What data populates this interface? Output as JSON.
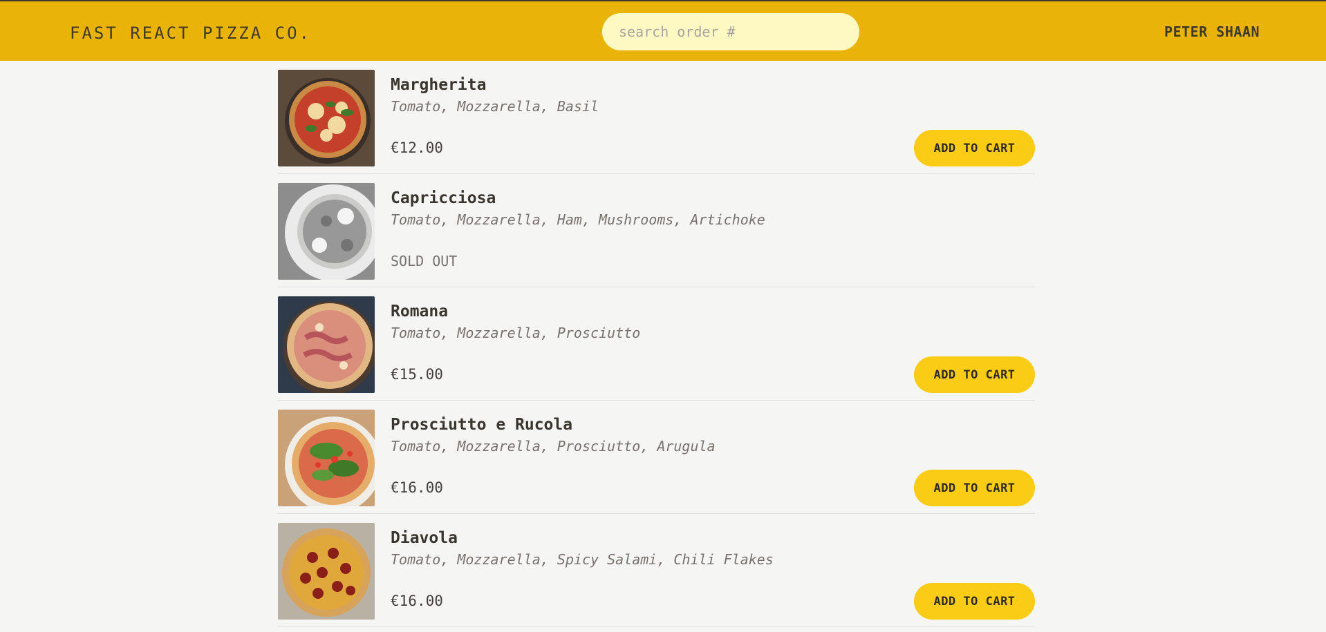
{
  "header": {
    "logo": "FAST REACT PIZZA CO.",
    "search_placeholder": "search order #",
    "search_value": "",
    "username": "PETER SHAAN"
  },
  "colors": {
    "header_bg": "#eab308",
    "button_bg": "#facc15",
    "search_bg": "#fef9c3",
    "page_bg": "#f5f5f4"
  },
  "menu": {
    "add_to_cart_label": "ADD TO CART",
    "sold_out_label": "SOLD OUT",
    "items": [
      {
        "name": "Margherita",
        "ingredients": "Tomato, Mozzarella, Basil",
        "price": "€12.00",
        "sold_out": false,
        "image_icon": "pizza-margherita-image"
      },
      {
        "name": "Capricciosa",
        "ingredients": "Tomato, Mozzarella, Ham, Mushrooms, Artichoke",
        "price": "",
        "sold_out": true,
        "image_icon": "pizza-capricciosa-image"
      },
      {
        "name": "Romana",
        "ingredients": "Tomato, Mozzarella, Prosciutto",
        "price": "€15.00",
        "sold_out": false,
        "image_icon": "pizza-romana-image"
      },
      {
        "name": "Prosciutto e Rucola",
        "ingredients": "Tomato, Mozzarella, Prosciutto, Arugula",
        "price": "€16.00",
        "sold_out": false,
        "image_icon": "pizza-prosciutto-rucola-image"
      },
      {
        "name": "Diavola",
        "ingredients": "Tomato, Mozzarella, Spicy Salami, Chili Flakes",
        "price": "€16.00",
        "sold_out": false,
        "image_icon": "pizza-diavola-image"
      }
    ]
  }
}
